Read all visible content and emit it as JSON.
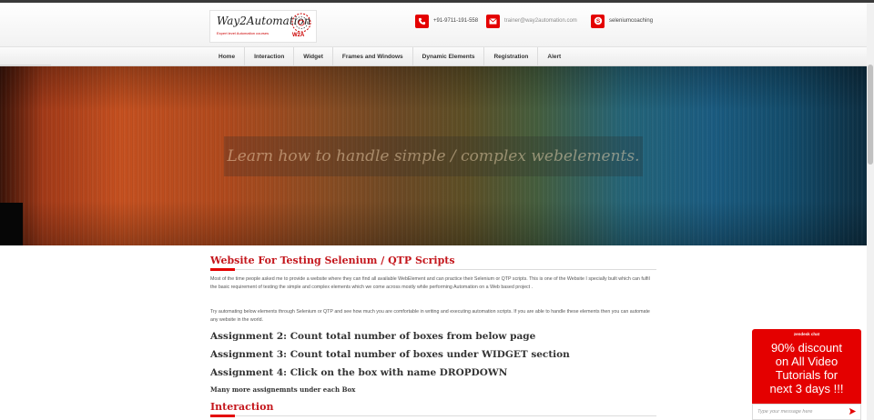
{
  "header": {
    "logo_title": "Way2Automation",
    "logo_subtitle": "Expert level Automation courses",
    "logo_badge": "W2A",
    "contacts": [
      {
        "icon": "phone-icon",
        "text": "+91-9711-191-558"
      },
      {
        "icon": "envelope-icon",
        "text": "trainer@way2automation.com"
      },
      {
        "icon": "skype-icon",
        "text": "seleniumcoaching"
      }
    ]
  },
  "nav": {
    "items": [
      "Home",
      "Interaction",
      "Widget",
      "Frames and Windows",
      "Dynamic Elements",
      "Registration",
      "Alert"
    ]
  },
  "banner": {
    "caption": "Learn how to handle simple / complex webelements."
  },
  "content": {
    "title": "Website For Testing Selenium / QTP Scripts",
    "paragraph1": "Most of the time people asked me to provide a website where they can find all available WebElement and can practice their Selenium or QTP scripts. This is one of the Website I specially built which can fulfil the basic requirement of testing the simple and complex elements which we come across mostly while performing Automation on a Web based project .",
    "paragraph2": "Try automating below elements through Selenium or QTP and see how much you are comfortable in writing and executing automation scripts. If you are able to handle these elements then you can automate any website in the world.",
    "assignments": [
      "Assignment 2: Count total number of boxes from below page",
      "Assignment 3: Count total number of boxes under WIDGET section",
      "Assignment 4: Click on the box with name DROPDOWN"
    ],
    "more": "Many more assignemnts under each Box",
    "section_title": "Interaction"
  },
  "chat": {
    "label": "zendesk chat",
    "message": "90% discount\non All Video\nTutorials for\nnext 3 days !!!",
    "placeholder": "Type your message here"
  },
  "colors": {
    "accent": "#e40000",
    "heading": "#c4161c"
  }
}
